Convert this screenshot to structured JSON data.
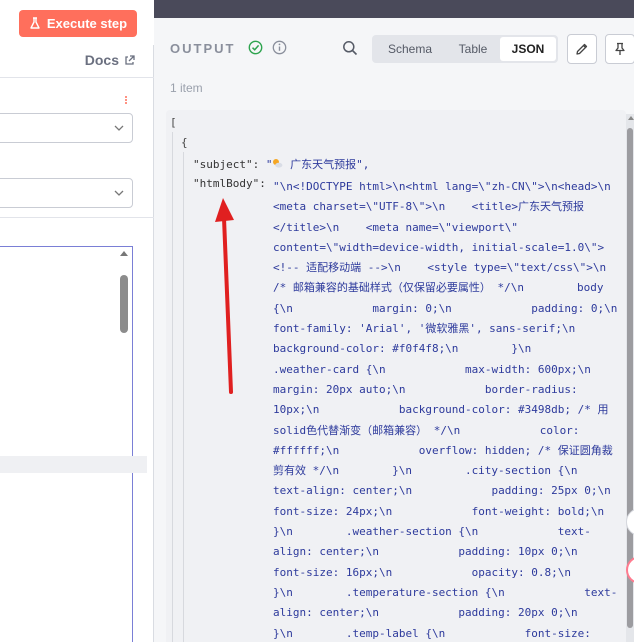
{
  "left": {
    "execute_label": "Execute step",
    "docs_label": "Docs"
  },
  "output": {
    "title": "OUTPUT",
    "item_count": "1 item",
    "tabs": [
      {
        "label": "Schema"
      },
      {
        "label": "Table"
      },
      {
        "label": "JSON"
      }
    ]
  },
  "json": {
    "open_bracket": "[",
    "open_brace": "{",
    "subject_key": "\"subject\":",
    "subject_value_pre": "\"",
    "subject_value_text": " 广东天气预报\",",
    "html_key": "\"htmlBody\":",
    "html_lines": [
      "\"\\n<!DOCTYPE html>\\n<html lang=\\\"zh-CN\\\">\\n<head>\\n",
      "<meta charset=\\\"UTF-8\\\">\\n    <title>广东天气预报",
      "</title>\\n    <meta name=\\\"viewport\\\"",
      "content=\\\"width=device-width, initial-scale=1.0\\\">",
      "<!-- 适配移动端 -->\\n    <style type=\\\"text/css\\\">\\n",
      "/* 邮箱兼容的基础样式（仅保留必要属性） */\\n        body",
      "{\\n            margin: 0;\\n            padding: 0;\\n",
      "font-family: 'Arial', '微软雅黑', sans-serif;\\n",
      "background-color: #f0f4f8;\\n        }\\n",
      ".weather-card {\\n            max-width: 600px;\\n",
      "margin: 20px auto;\\n            border-radius:",
      "10px;\\n            background-color: #3498db; /* 用",
      "solid色代替渐变（邮箱兼容） */\\n            color:",
      "#ffffff;\\n            overflow: hidden; /* 保证圆角裁",
      "剪有效 */\\n        }\\n        .city-section {\\n",
      "text-align: center;\\n            padding: 25px 0;\\n",
      "font-size: 24px;\\n            font-weight: bold;\\n",
      "}\\n        .weather-section {\\n            text-",
      "align: center;\\n            padding: 10px 0;\\n",
      "font-size: 16px;\\n            opacity: 0.8;\\n",
      "}\\n        .temperature-section {\\n            text-",
      "align: center;\\n            padding: 20px 0;\\n",
      "}\\n        .temp-label {\\n            font-size:"
    ]
  },
  "colors": {
    "accent": "#ff6f5c",
    "json_string": "#2d3a9c",
    "success": "#2ea44f",
    "arrow": "#e02020"
  }
}
